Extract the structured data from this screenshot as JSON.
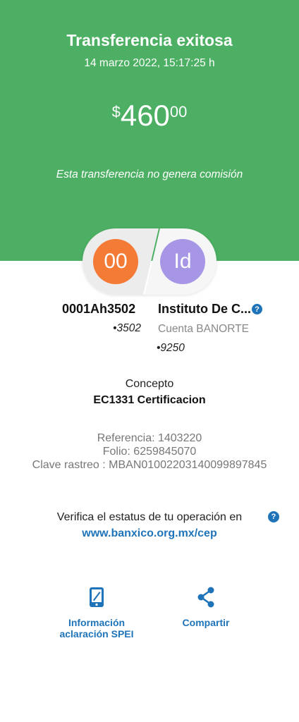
{
  "header": {
    "title": "Transferencia exitosa",
    "datetime": "14 marzo 2022, 15:17:25 h",
    "amount": {
      "currency": "$",
      "integer": "460",
      "decimals": "00"
    },
    "fee_note": "Esta transferencia no genera comisión"
  },
  "accounts": {
    "origin": {
      "avatar": "00",
      "name": "0001Ah3502",
      "number": "•3502",
      "color": "#f47b36"
    },
    "destination": {
      "avatar": "Id",
      "name": "Instituto De C...",
      "bank": "Cuenta BANORTE",
      "number": "•9250",
      "color": "#a795e6",
      "help": "?"
    }
  },
  "concept": {
    "label": "Concepto",
    "value": "EC1331 Certificacion"
  },
  "references": {
    "referencia": "Referencia: 1403220",
    "folio": "Folio: 6259845070",
    "clave": "Clave rastreo : MBAN01002203140099897845"
  },
  "verify": {
    "text": "Verifica el estatus de tu operación en",
    "help": "?",
    "link": "www.banxico.org.mx/cep"
  },
  "actions": [
    {
      "label_line1": "Información",
      "label_line2": "aclaración SPEI",
      "icon": "phone-icon"
    },
    {
      "label": "Compartir",
      "icon": "share-icon"
    }
  ],
  "colors": {
    "header_bg": "#4caf63",
    "accent": "#1f74b9"
  }
}
